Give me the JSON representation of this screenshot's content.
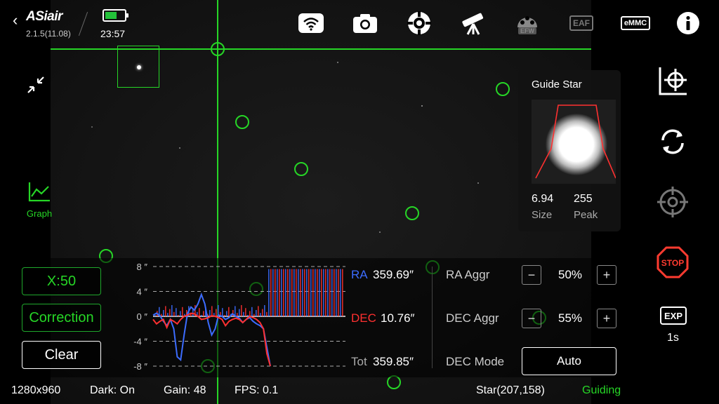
{
  "header": {
    "back_glyph": "‹",
    "logo": "ASiair",
    "version": "2.1.5(11.08)",
    "time": "23:57",
    "battery_level": 0.6,
    "icons": [
      "wifi-icon",
      "camera-icon",
      "mount-icon",
      "telescope-icon",
      "efw-icon",
      "eaf-icon",
      "emmc-icon",
      "info-icon"
    ],
    "efw_label": "EFW",
    "eaf_label": "EAF",
    "emmc_label": "eMMC"
  },
  "left": {
    "graph_label": "Graph"
  },
  "controls": {
    "x_label": "X:50",
    "correction_label": "Correction",
    "clear_label": "Clear"
  },
  "chart_data": {
    "type": "bar",
    "y_ticks": [
      "8 ″",
      "4 ″",
      "0 ″",
      "-4 ″",
      "-8 ″"
    ],
    "ylim": [
      -8,
      8
    ],
    "series": [
      {
        "name": "RA",
        "color": "#3c6cff"
      },
      {
        "name": "DEC",
        "color": "#ff3030"
      }
    ]
  },
  "stats": {
    "ra_label": "RA",
    "ra_value": "359.69″",
    "dec_label": "DEC",
    "dec_value": "10.76″",
    "tot_label": "Tot",
    "tot_value": "359.85″"
  },
  "aggr": {
    "ra_label": "RA Aggr",
    "ra_value": "50%",
    "dec_label": "DEC Aggr",
    "dec_value": "55%",
    "mode_label": "DEC Mode",
    "mode_value": "Auto",
    "minus": "−",
    "plus": "+"
  },
  "guide_star": {
    "title": "Guide Star",
    "size_value": "6.94",
    "size_label": "Size",
    "peak_value": "255",
    "peak_label": "Peak"
  },
  "sidebar": {
    "stop_label": "STOP",
    "exp_label": "EXP",
    "exp_value": "1s"
  },
  "status": {
    "resolution": "1280x960",
    "dark": "Dark: On",
    "gain": "Gain: 48",
    "fps": "FPS: 0.1",
    "star": "Star(207,158)",
    "state": "Guiding"
  },
  "colors": {
    "accent_green": "#26d626",
    "ra_blue": "#3c6cff",
    "dec_red": "#ff3030",
    "stop_red": "#ff3b30"
  }
}
